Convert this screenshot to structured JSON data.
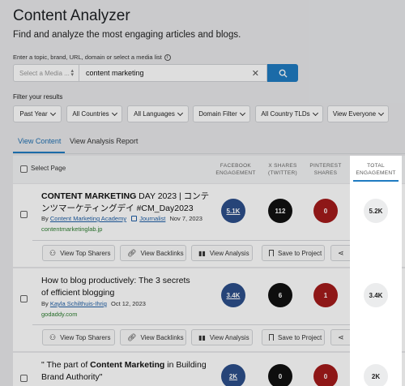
{
  "page": {
    "title": "Content Analyzer",
    "subtitle": "Find and analyze the most engaging articles and blogs."
  },
  "search": {
    "label": "Enter a topic, brand, URL, domain or select a media list",
    "media_select_placeholder": "Select a Media ...",
    "query": "content marketing"
  },
  "filters": {
    "label": "Filter your results",
    "items": [
      "Past Year",
      "All Countries",
      "All Languages",
      "Domain Filter",
      "All Country TLDs",
      "View Everyone"
    ]
  },
  "tabs": [
    "View Content",
    "View Analysis Report"
  ],
  "table": {
    "select_page": "Select Page",
    "columns": {
      "facebook": [
        "FACEBOOK",
        "ENGAGEMENT"
      ],
      "x": [
        "X SHARES",
        "(TWITTER)"
      ],
      "pinterest": [
        "PINTEREST",
        "SHARES"
      ],
      "total": [
        "TOTAL",
        "ENGAGEMENT"
      ]
    }
  },
  "actions": {
    "top_sharers": "View Top Sharers",
    "backlinks": "View Backlinks",
    "analysis": "View Analysis",
    "save": "Save to Project"
  },
  "articles": [
    {
      "title_bold": "CONTENT MARKETING",
      "title_rest": " DAY 2023 | コンテンツマーケティングデイ #CM_Day2023",
      "by": "By",
      "author": "Content Marketing Academy",
      "source_type": "Journalist",
      "date": "Nov 7, 2023",
      "domain": "contentmarketinglab.jp",
      "facebook": "5.1K",
      "x": "112",
      "pinterest": "0",
      "total": "5.2K"
    },
    {
      "title_bold": "",
      "title_rest": "How to blog productively: The 3 secrets of efficient blogging",
      "by": "By",
      "author": "Kayla Schilthuis-Ihrig",
      "source_type": "",
      "date": "Oct 12, 2023",
      "domain": "godaddy.com",
      "facebook": "3.4K",
      "x": "6",
      "pinterest": "1",
      "total": "3.4K"
    },
    {
      "title_pre": "\" The part of ",
      "title_bold": "Content Marketing",
      "title_rest": " in Building Brand Authority\"",
      "facebook": "2K",
      "x": "0",
      "pinterest": "0",
      "total": "2K"
    }
  ]
}
